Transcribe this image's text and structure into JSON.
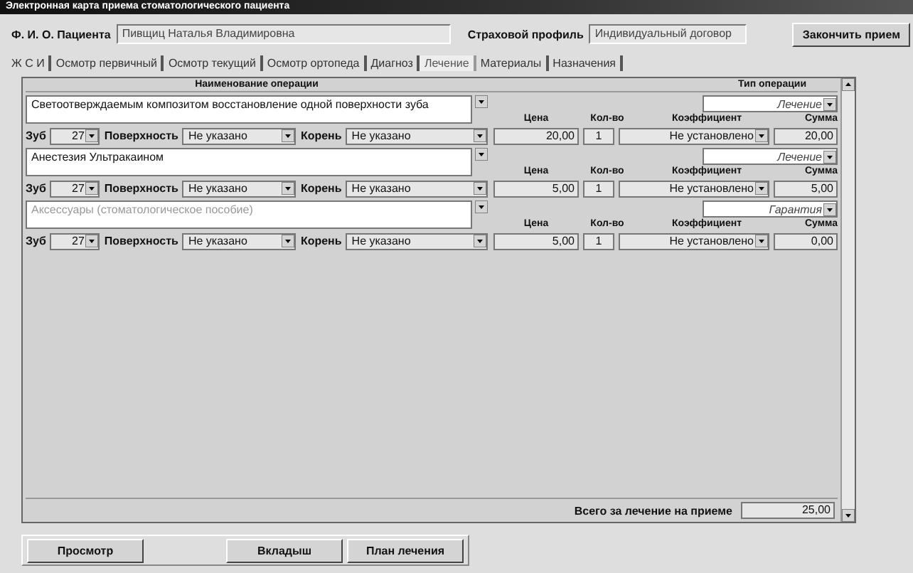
{
  "window": {
    "title": "Электронная карта приема стоматологического пациента"
  },
  "patient": {
    "label": "Ф. И. О. Пациента",
    "value": "Пивщиц Наталья Владимировна",
    "insurance_label": "Страховой профиль",
    "insurance_value": "Индивидуальный договор",
    "finish_button": "Закончить прием"
  },
  "tabs": [
    {
      "label": "Ж С И",
      "selected": false
    },
    {
      "label": "Осмотр первичный",
      "selected": false
    },
    {
      "label": "Осмотр текущий",
      "selected": false
    },
    {
      "label": "Осмотр ортопеда",
      "selected": false
    },
    {
      "label": "Диагноз",
      "selected": false
    },
    {
      "label": "Лечение",
      "selected": true
    },
    {
      "label": "Материалы",
      "selected": false
    },
    {
      "label": "Назначения",
      "selected": false
    }
  ],
  "table": {
    "name_header": "Наименование операции",
    "type_header": "Тип операции",
    "operations": [
      {
        "name": "Светоотверждаемым композитом восстановление одной поверхности зуба",
        "disabled": false,
        "type": "Лечение",
        "tooth_label": "Зуб",
        "tooth": "27",
        "surface_label": "Поверхность",
        "surface": "Не указано",
        "root_label": "Корень",
        "root": "Не указано",
        "price_label": "Цена",
        "price": "20,00",
        "qty_label": "Кол-во",
        "qty": "1",
        "coef_label": "Коэффициент",
        "coef": "Не установлено",
        "sum_label": "Сумма",
        "sum": "20,00"
      },
      {
        "name": "Анестезия Ультракаином",
        "disabled": false,
        "type": "Лечение",
        "tooth_label": "Зуб",
        "tooth": "27",
        "surface_label": "Поверхность",
        "surface": "Не указано",
        "root_label": "Корень",
        "root": "Не указано",
        "price_label": "Цена",
        "price": "5,00",
        "qty_label": "Кол-во",
        "qty": "1",
        "coef_label": "Коэффициент",
        "coef": "Не установлено",
        "sum_label": "Сумма",
        "sum": "5,00"
      },
      {
        "name": "Аксессуары (стоматологическое пособие)",
        "disabled": true,
        "type": "Гарантия",
        "tooth_label": "Зуб",
        "tooth": "27",
        "surface_label": "Поверхность",
        "surface": "Не указано",
        "root_label": "Корень",
        "root": "Не указано",
        "price_label": "Цена",
        "price": "5,00",
        "qty_label": "Кол-во",
        "qty": "1",
        "coef_label": "Коэффициент",
        "coef": "Не установлено",
        "sum_label": "Сумма",
        "sum": "0,00"
      }
    ],
    "total_label": "Всего за лечение на приеме",
    "total": "25,00"
  },
  "buttons": [
    {
      "label": "Просмотр"
    },
    {
      "label": "Вкладыш"
    },
    {
      "label": "План лечения"
    }
  ]
}
